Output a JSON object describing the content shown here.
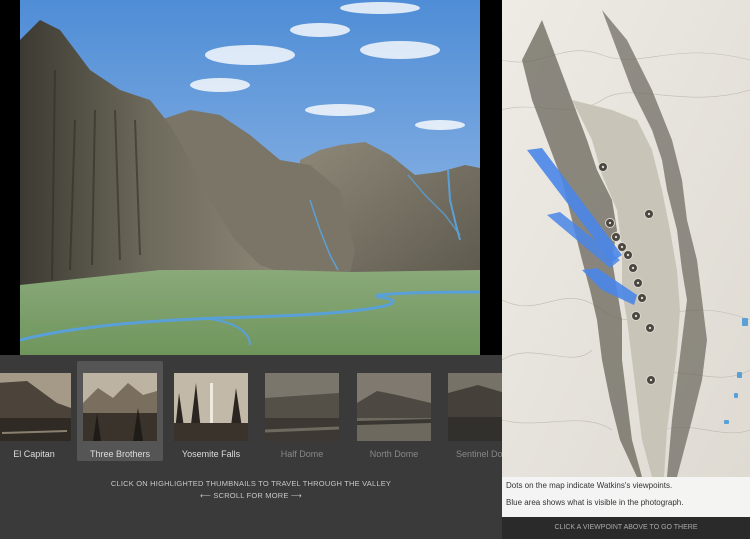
{
  "thumbnails": [
    {
      "label": "El Capitan",
      "state": "available"
    },
    {
      "label": "Three Brothers",
      "state": "selected"
    },
    {
      "label": "Yosemite Falls",
      "state": "available"
    },
    {
      "label": "Half Dome",
      "state": "dimmed"
    },
    {
      "label": "North Dome",
      "state": "dimmed"
    },
    {
      "label": "Sentinel Do",
      "state": "dimmed"
    }
  ],
  "instructions": {
    "line1": "CLICK ON HIGHLIGHTED THUMBNAILS TO TRAVEL THROUGH THE VALLEY",
    "scroll": "⟵ SCROLL FOR MORE ⟶"
  },
  "map": {
    "caption_line1": "Dots on the map indicate Watkins's viewpoints.",
    "caption_line2": "Blue area shows what is visible in the photograph.",
    "footer": "CLICK A VIEWPOINT ABOVE TO GO THERE"
  },
  "colors": {
    "sky": "#5a95d8",
    "valley_floor": "#7e9e68",
    "river": "#5aa0d8",
    "viewshed": "#4a86e8",
    "panel_bg": "#3a3a3a"
  }
}
